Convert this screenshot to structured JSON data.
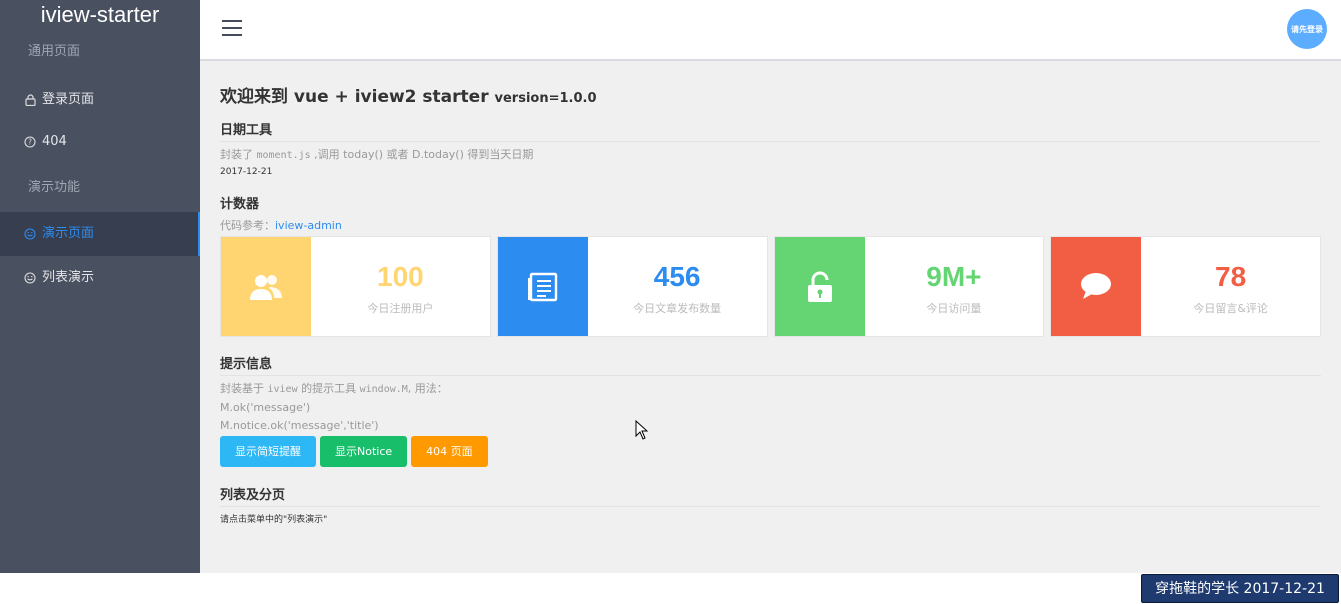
{
  "sidebar": {
    "brand": "iview-starter",
    "groups": [
      {
        "title": "通用页面"
      },
      {
        "title": "演示功能"
      }
    ],
    "items": [
      {
        "label": "登录页面",
        "icon": "lock-icon"
      },
      {
        "label": "404",
        "icon": "help-circle-icon"
      },
      {
        "label": "演示页面",
        "icon": "face-icon",
        "active": true
      },
      {
        "label": "列表演示",
        "icon": "face-icon"
      }
    ]
  },
  "header": {
    "avatar_text": "请先登录"
  },
  "main": {
    "title": "欢迎来到 vue + iview2 starter",
    "version": "version=1.0.0",
    "date_tool": {
      "title": "日期工具",
      "desc_prefix": "封装了 ",
      "desc_code": "moment.js",
      "desc_suffix": " ,调用 today() 或者 D.today() 得到当天日期",
      "date": "2017-12-21"
    },
    "counter": {
      "title": "计数器",
      "ref_label": "代码参考：",
      "ref_link": "iview-admin",
      "cards": [
        {
          "value": "100",
          "label": "今日注册用户",
          "color": "#ffd572",
          "icon": "users-icon"
        },
        {
          "value": "456",
          "label": "今日文章发布数量",
          "color": "#2d8cf0",
          "icon": "document-icon"
        },
        {
          "value": "9M+",
          "label": "今日访问量",
          "color": "#64d572",
          "icon": "unlock-icon"
        },
        {
          "value": "78",
          "label": "今日留言&评论",
          "color": "#f25e43",
          "icon": "chat-icon"
        }
      ]
    },
    "tips": {
      "title": "提示信息",
      "line1_prefix": "封装基于 ",
      "line1_code1": "iview",
      "line1_mid": " 的提示工具 ",
      "line1_code2": "window.M",
      "line1_suffix": ", 用法：",
      "line2": "M.ok('message')",
      "line3": "M.notice.ok('message','title')",
      "buttons": [
        {
          "label": "显示简短提醒",
          "color": "#2db7f5"
        },
        {
          "label": "显示Notice",
          "color": "#19be6b"
        },
        {
          "label": "404 页面",
          "color": "#ff9900"
        }
      ]
    },
    "list": {
      "title": "列表及分页",
      "desc": "请点击菜单中的\"列表演示\""
    }
  },
  "watermark": "穿拖鞋的学长 2017-12-21"
}
